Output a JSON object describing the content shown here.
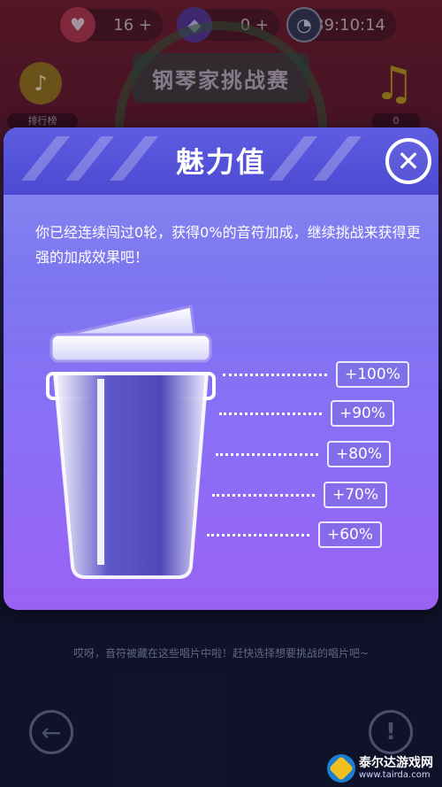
{
  "hud": {
    "hearts": "16 +",
    "gems": "0 +",
    "timer": "39:10:14"
  },
  "game": {
    "title": "钢琴家挑战赛",
    "rank_label": "排行榜",
    "note_count": "0",
    "hint": "哎呀，音符被藏在这些唱片中啦！赶快选择想要挑战的唱片吧~"
  },
  "modal": {
    "title": "魅力值",
    "close_symbol": "✕",
    "description": "你已经连续闯过0轮，获得0%的音符加成，继续挑战来获得更强的加成效果吧！",
    "tiers": [
      {
        "label": "+100%"
      },
      {
        "label": "+90%"
      },
      {
        "label": "+80%"
      },
      {
        "label": "+70%"
      },
      {
        "label": "+60%"
      }
    ],
    "fill_fraction": 0
  },
  "watermark": {
    "title": "泰尔达游戏网",
    "url": "www.tairda.com"
  },
  "icons": {
    "heart": "heart-icon",
    "gem": "gem-icon",
    "clock": "clock-icon",
    "rank": "music-note-medal-icon",
    "note": "music-note-icon",
    "close": "close-icon",
    "back": "arrow-left-icon",
    "info": "exclamation-icon"
  },
  "colors": {
    "modal_header": "#4c4ad2",
    "modal_body": "#8a6ef6",
    "accent": "#ffffff"
  }
}
